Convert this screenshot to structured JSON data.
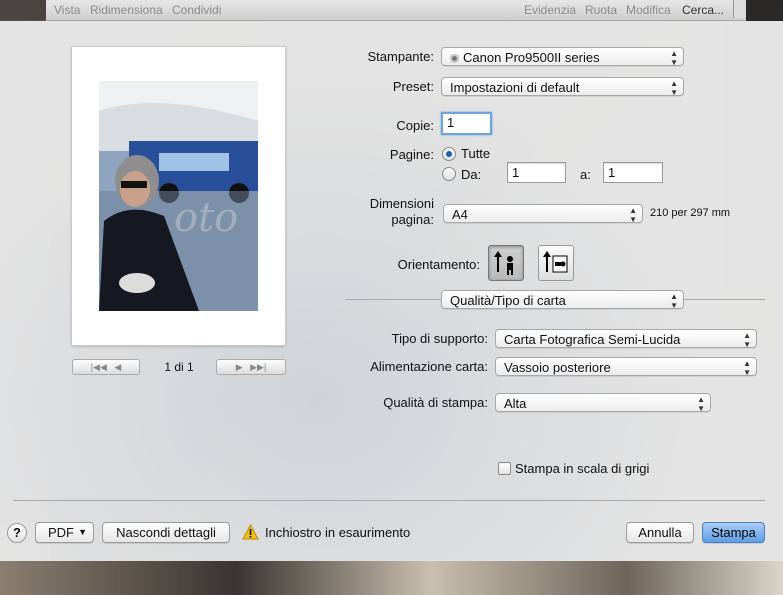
{
  "menubar": {
    "items_left": [
      "Vista",
      "Ridimensiona",
      "Condividi"
    ],
    "items_right": [
      "Evidenzia",
      "Ruota",
      "Modifica",
      "Cerca..."
    ]
  },
  "preview": {
    "page_indicator": "1 di 1"
  },
  "printer": {
    "label": "Stampante:",
    "value": "Canon Pro9500II series"
  },
  "preset": {
    "label": "Preset:",
    "value": "Impostazioni di default"
  },
  "copies": {
    "label": "Copie:",
    "value": "1"
  },
  "pages": {
    "label": "Pagine:",
    "all_label": "Tutte",
    "from_label": "Da:",
    "from_value": "1",
    "to_label": "a:",
    "to_value": "1",
    "selected": "Tutte"
  },
  "paper_size": {
    "label_line1": "Dimensioni",
    "label_line2": "pagina:",
    "value": "A4",
    "dimensions": "210 per 297 mm"
  },
  "orientation": {
    "label": "Orientamento:",
    "selected": "portrait",
    "icons": [
      "portrait-orientation-icon",
      "landscape-orientation-icon"
    ]
  },
  "section": {
    "value": "Qualità/Tipo di carta"
  },
  "media_type": {
    "label": "Tipo di supporto:",
    "value": "Carta Fotografica Semi-Lucida"
  },
  "paper_source": {
    "label": "Alimentazione carta:",
    "value": "Vassoio posteriore"
  },
  "print_quality": {
    "label": "Qualità di stampa:",
    "value": "Alta"
  },
  "grayscale": {
    "label": "Stampa in scala di grigi",
    "checked": false
  },
  "footer": {
    "help": "?",
    "pdf": "PDF",
    "hide_details": "Nascondi dettagli",
    "warning": "Inchiostro in esaurimento",
    "cancel": "Annulla",
    "print": "Stampa"
  },
  "colors": {
    "accent": "#5c9ee6",
    "warning": "#f2c21a"
  }
}
